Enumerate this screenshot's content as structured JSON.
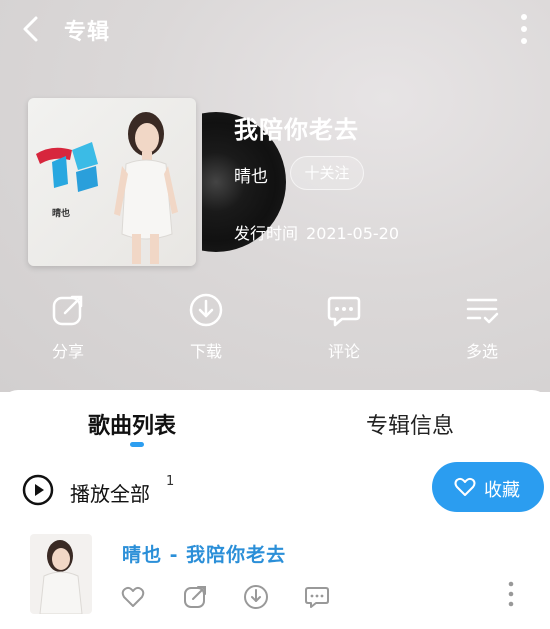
{
  "header": {
    "title": "专辑",
    "back_icon": "chevron-left-icon",
    "more_icon": "vertical-dots-icon"
  },
  "album": {
    "title": "我陪你老去",
    "artist": "晴也",
    "follow_label": "十关注",
    "release_label": "发行时间",
    "release_date": "2021-05-20",
    "cover_artist": "晴也"
  },
  "actions": [
    {
      "label": "分享",
      "icon": "share-icon"
    },
    {
      "label": "下载",
      "icon": "download-icon"
    },
    {
      "label": "评论",
      "icon": "comment-icon"
    },
    {
      "label": "多选",
      "icon": "multi-select-icon"
    }
  ],
  "tabs": {
    "songs": "歌曲列表",
    "info": "专辑信息"
  },
  "playlist": {
    "play_all": "播放全部",
    "count": "1",
    "collect": "收藏"
  },
  "song": {
    "title": "晴也 - 我陪你老去"
  },
  "colors": {
    "accent": "#2b9df0",
    "song_title": "#2b8fd8"
  }
}
